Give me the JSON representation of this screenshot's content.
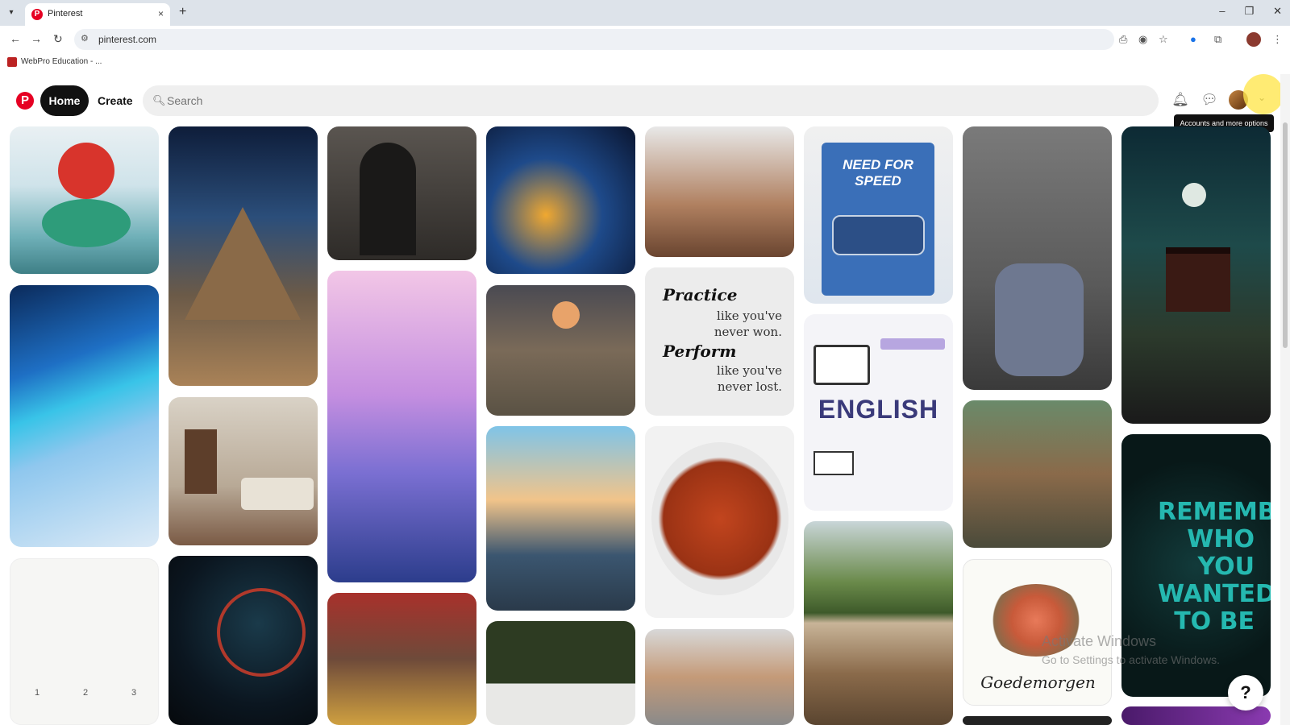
{
  "browser": {
    "tab_title": "Pinterest",
    "tab_close": "×",
    "new_tab": "+",
    "url": "pinterest.com",
    "bookmark_label": "WebPro Education - ...",
    "window_controls": [
      "–",
      "❐",
      "✕"
    ]
  },
  "header": {
    "logo": "P",
    "home_label": "Home",
    "create_label": "Create",
    "search_placeholder": "Search",
    "tooltip": "Accounts and more options"
  },
  "pins": {
    "practice_line1": "Practice",
    "practice_line2": "like you've never won.",
    "perform_line1": "Perform",
    "perform_line2": "like you've never lost.",
    "english": "ENGLISH",
    "nfs": "NEED FOR SPEED",
    "remember": "REMEMBER WHO YOU WANTED TO BE",
    "goedemorgen": "Goedemorgen",
    "sketch_numbers": [
      "1",
      "2",
      "3"
    ]
  },
  "overlay": {
    "activate_line1": "Activate Windows",
    "activate_line2": "Go to Settings to activate Windows.",
    "help": "?"
  },
  "colors": {
    "brand": "#e60023",
    "home_bg": "#111111"
  }
}
